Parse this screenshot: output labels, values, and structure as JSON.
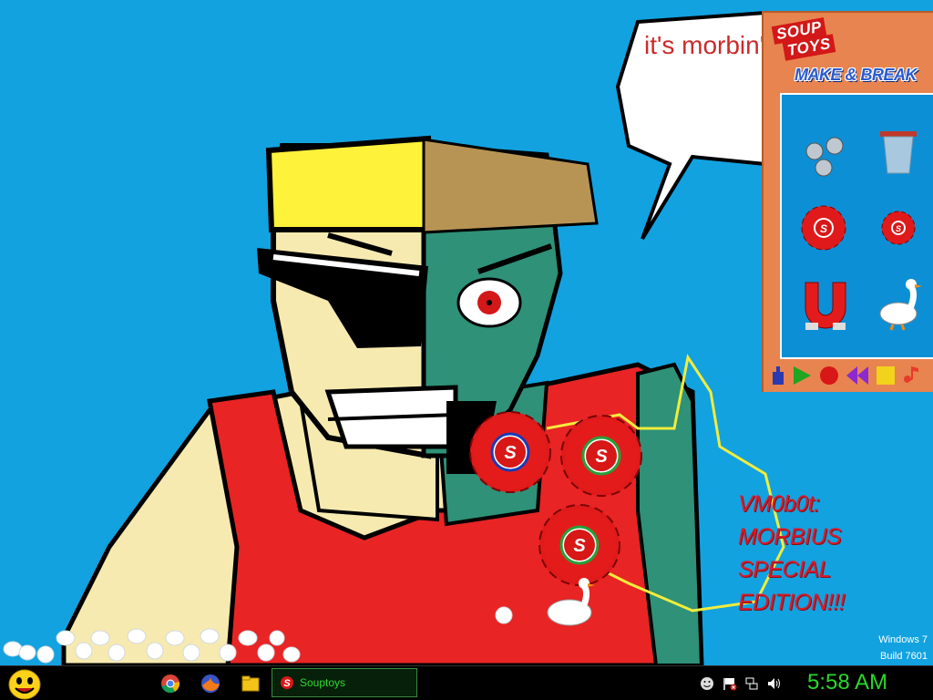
{
  "desktop": {
    "speech_bubble_text": "it's morbin' time",
    "corner_text_lines": [
      "VM0b0t:",
      "MORBIUS",
      "SPECIAL",
      "EDITION!!!"
    ],
    "windows_build": [
      "Windows 7",
      "Build 7601"
    ],
    "wallpaper_color": "#12a2e0"
  },
  "soup_window": {
    "logo_lines": [
      "SOUP",
      "TOYS"
    ],
    "heading": "MAKE & BREAK",
    "toys": [
      "ball-bearings-icon",
      "bucket-icon",
      "big-cog-icon",
      "small-cog-icon",
      "magnet-icon",
      "goose-icon"
    ],
    "toolbar": [
      "pump-icon",
      "play-icon",
      "record-icon",
      "rewind-icon",
      "stop-icon",
      "note-icon"
    ]
  },
  "taskbar": {
    "pinned": [
      "chrome-icon",
      "firefox-icon",
      "explorer-icon"
    ],
    "active_app_label": "Souptoys",
    "tray": [
      "smiley-icon",
      "flag-icon",
      "network-icon",
      "volume-icon"
    ],
    "clock": "5:58 AM",
    "accent": "#2ad82a"
  }
}
